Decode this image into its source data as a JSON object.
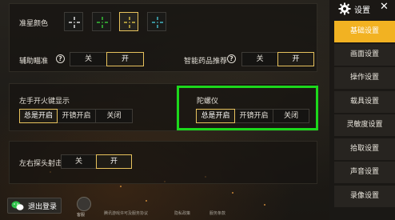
{
  "sidebar": {
    "title": "设置",
    "close": "✕",
    "items": [
      {
        "label": "基础设置",
        "active": true
      },
      {
        "label": "画面设置",
        "active": false
      },
      {
        "label": "操作设置",
        "active": false
      },
      {
        "label": "载具设置",
        "active": false
      },
      {
        "label": "灵敏度设置",
        "active": false
      },
      {
        "label": "拾取设置",
        "active": false
      },
      {
        "label": "声音设置",
        "active": false
      },
      {
        "label": "录像设置",
        "active": false
      }
    ]
  },
  "crosshair": {
    "label": "准星颜色",
    "colors": [
      "#ffffff",
      "#3cdc3c",
      "#f0d24a",
      "#4ad0e0"
    ],
    "selected": 2
  },
  "aim_assist": {
    "label": "辅助瞄准",
    "options": [
      "关",
      "开"
    ],
    "selected": 1
  },
  "smart_med": {
    "label": "智能药品推荐",
    "options": [
      "关",
      "开"
    ],
    "selected": 1
  },
  "left_fire": {
    "label": "左手开火键显示",
    "options": [
      "总是开启",
      "开镜开启",
      "关闭"
    ],
    "selected": 0
  },
  "gyro": {
    "label": "陀螺仪",
    "options": [
      "总是开启",
      "开镜开启",
      "关闭"
    ],
    "selected": 0
  },
  "peek": {
    "label": "左右探头射击",
    "options": [
      "关",
      "开"
    ],
    "selected": 1
  },
  "footer": {
    "logout": "退出登录",
    "service": "客服",
    "links": [
      "腾讯游戏许可及服务协议",
      "隐私政策",
      "服务条款"
    ]
  },
  "colors": {
    "accent": "#f2b222",
    "highlight": "#1cd81c",
    "selected_border": "#e7c25d"
  }
}
